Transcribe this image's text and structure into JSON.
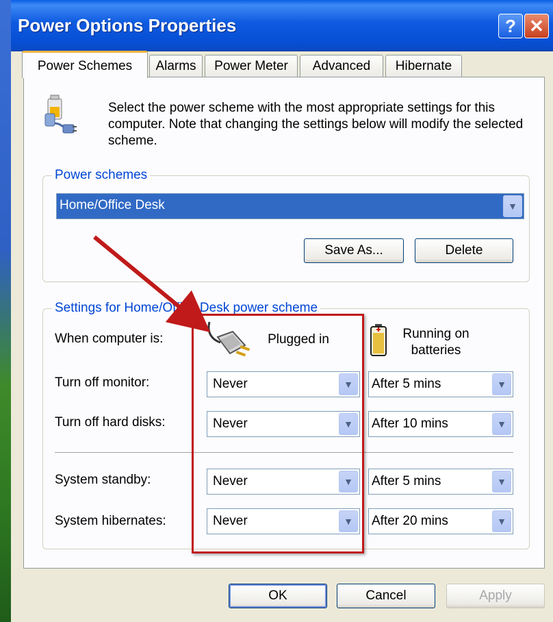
{
  "window": {
    "title": "Power Options Properties",
    "help_glyph": "?",
    "close_glyph": "✕"
  },
  "tabs": [
    {
      "label": "Power Schemes",
      "active": true
    },
    {
      "label": "Alarms"
    },
    {
      "label": "Power Meter"
    },
    {
      "label": "Advanced"
    },
    {
      "label": "Hibernate"
    }
  ],
  "intro": {
    "icon": "power-scheme-icon",
    "text": "Select the power scheme with the most appropriate settings for this computer. Note that changing the settings below will modify the selected scheme."
  },
  "power_schemes": {
    "legend": "Power schemes",
    "selected": "Home/Office Desk",
    "save_as_label": "Save As...",
    "delete_label": "Delete"
  },
  "settings": {
    "legend": "Settings for Home/Office Desk power scheme",
    "when_label": "When computer is:",
    "plugged_in_label": "Plugged in",
    "batteries_label_1": "Running on",
    "batteries_label_2": "batteries",
    "rows": [
      {
        "label": "Turn off monitor:",
        "plugged": "Never",
        "battery": "After 5 mins"
      },
      {
        "label": "Turn off hard disks:",
        "plugged": "Never",
        "battery": "After 10 mins"
      },
      {
        "label": "System standby:",
        "plugged": "Never",
        "battery": "After 5 mins"
      },
      {
        "label": "System hibernates:",
        "plugged": "Never",
        "battery": "After 20 mins"
      }
    ]
  },
  "buttons": {
    "ok": "OK",
    "cancel": "Cancel",
    "apply": "Apply"
  },
  "colors": {
    "titlebar": "#0750d6",
    "selection": "#316ac5",
    "annotation": "#c01a1a",
    "legend_text": "#0046d5"
  }
}
